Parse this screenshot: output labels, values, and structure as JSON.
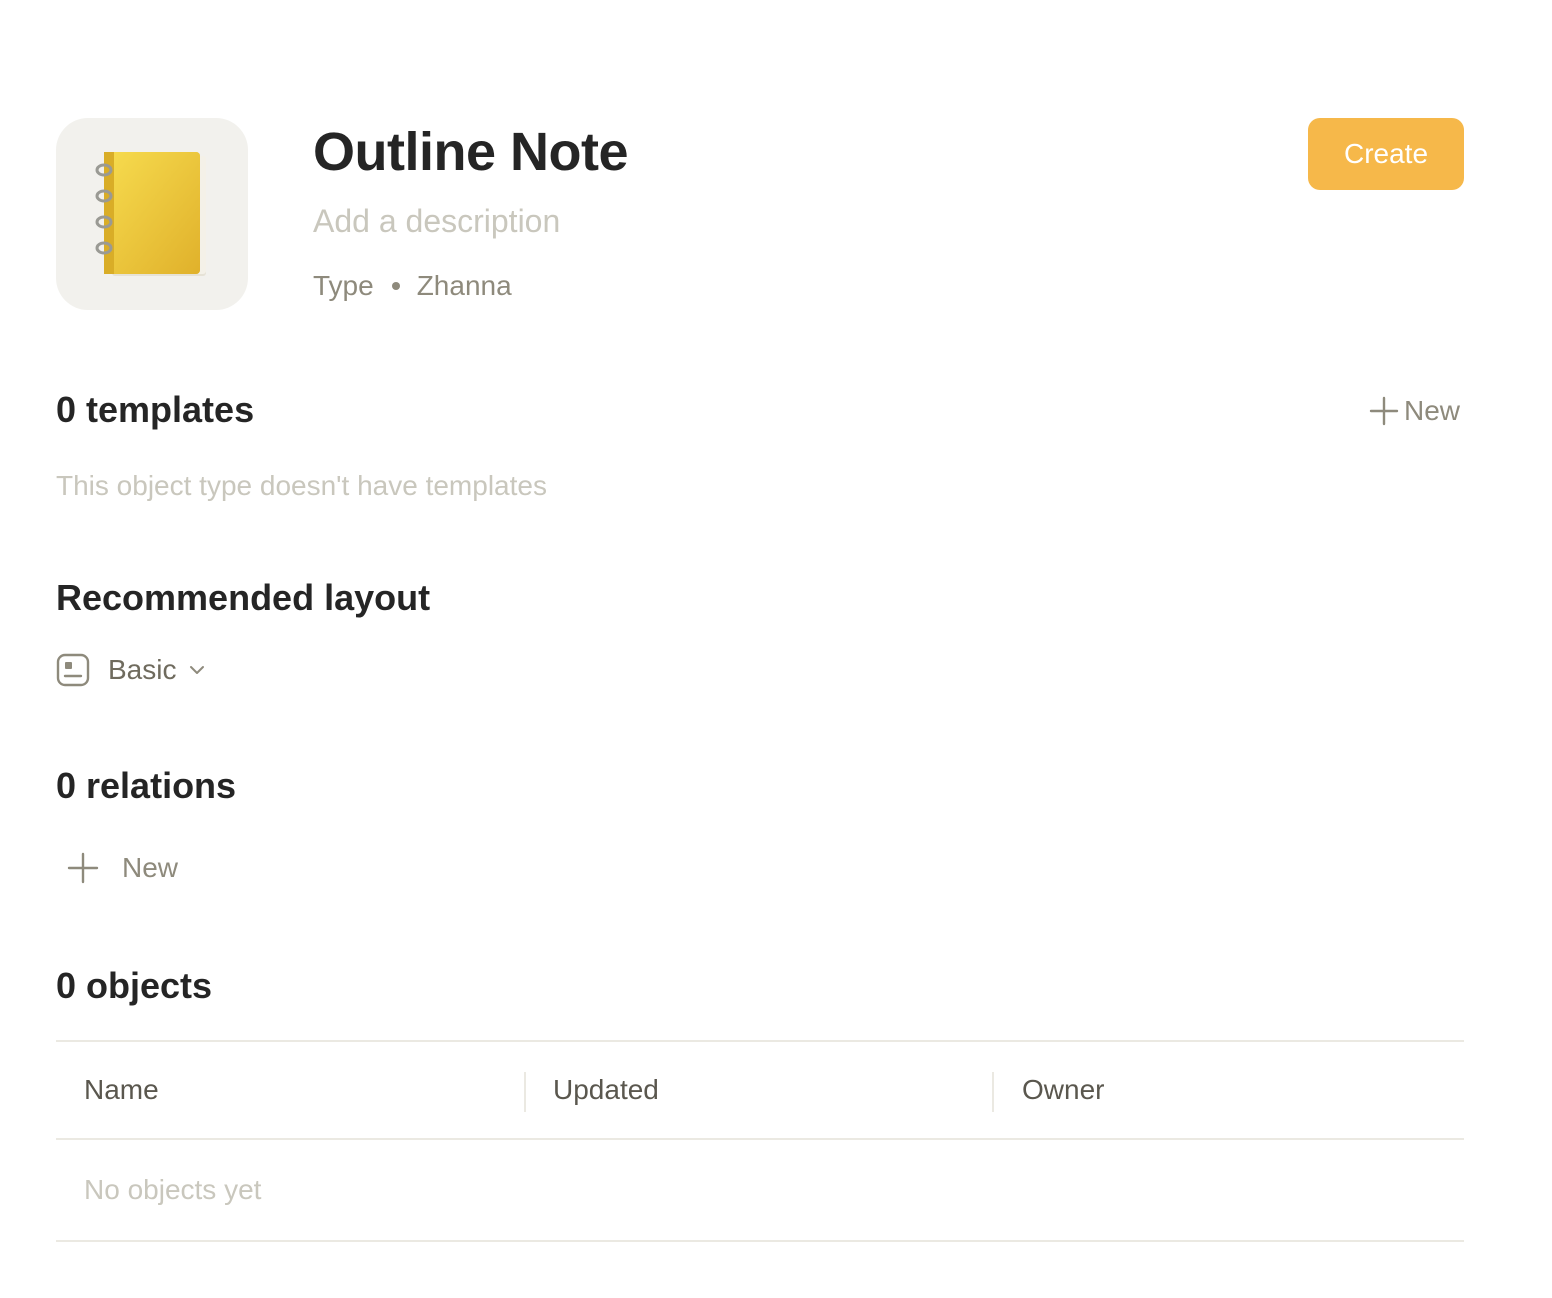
{
  "header": {
    "title": "Outline Note",
    "description_placeholder": "Add a description",
    "meta_type": "Type",
    "meta_owner": "Zhanna",
    "icon": "spiral-notebook-icon",
    "create_label": "Create"
  },
  "templates": {
    "title": "0 templates",
    "new_label": "New",
    "empty_text": "This object type doesn't have templates"
  },
  "layout": {
    "title": "Recommended layout",
    "selected": "Basic"
  },
  "relations": {
    "title": "0 relations",
    "new_label": "New"
  },
  "objects": {
    "title": "0 objects",
    "columns": [
      "Name",
      "Updated",
      "Owner"
    ],
    "empty_text": "No objects yet"
  },
  "colors": {
    "accent": "#f6b84a",
    "text_primary": "#252525",
    "text_secondary": "#8e8a7c",
    "text_muted": "#c9c7bd",
    "divider": "#ebe9e2"
  }
}
